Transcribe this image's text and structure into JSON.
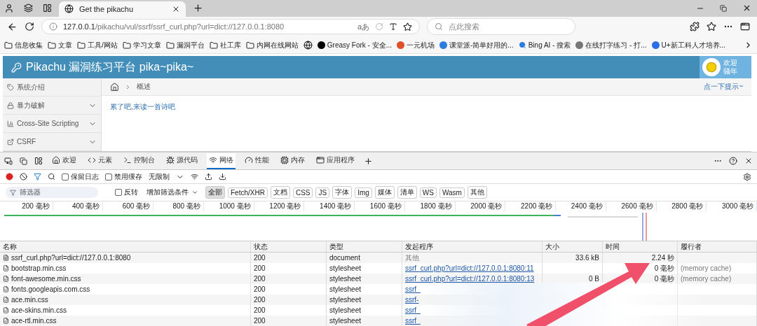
{
  "browser": {
    "tab_title": "Get the pikachu",
    "url_host": "127.0.0.1",
    "url_path": "/pikachu/vul/ssrf/ssrf_curl.php?url=dict://127.0.0.1:8080",
    "search_placeholder": "点此搜索",
    "translate_label": "aあ"
  },
  "bookmarks": [
    {
      "kind": "folder",
      "label": "信息收集"
    },
    {
      "kind": "folder",
      "label": "文章"
    },
    {
      "kind": "folder",
      "label": "工具/网站"
    },
    {
      "kind": "folder",
      "label": "学习文章"
    },
    {
      "kind": "folder",
      "label": "漏洞平台"
    },
    {
      "kind": "folder",
      "label": "社工库"
    },
    {
      "kind": "folder",
      "label": "内网在线网站"
    },
    {
      "kind": "globe"
    },
    {
      "kind": "site",
      "label": "Greasy Fork - 安全...",
      "color": "#000000"
    },
    {
      "kind": "site",
      "label": "一元机场",
      "color": "#e0502a"
    },
    {
      "kind": "site",
      "label": "课堂派-简单好用的...",
      "color": "#2b7de0"
    },
    {
      "kind": "search",
      "label": "Bing AI - 搜索",
      "color": "#2b7de0"
    },
    {
      "kind": "site",
      "label": "在线打字练习 - 打...",
      "color": "#777777"
    },
    {
      "kind": "site",
      "label": "U+新工科人才培养...",
      "color": "#2b6de8"
    }
  ],
  "site": {
    "title": "Pikachu 漏洞练习平台 pika~pika~",
    "welcome": "欢迎",
    "user": "骚年",
    "sidebar": [
      {
        "label": "系统介绍",
        "expandable": false
      },
      {
        "label": "暴力破解",
        "expandable": true
      },
      {
        "label": "Cross-Site Scripting",
        "expandable": true
      },
      {
        "label": "CSRF",
        "expandable": true
      }
    ],
    "breadcrumb": "概述",
    "hint": "点一下提示~",
    "poem_link": "累了吧,来读一首诗吧"
  },
  "devtools": {
    "tabs": [
      {
        "label": "欢迎",
        "selected": false
      },
      {
        "label": "元素",
        "selected": false
      },
      {
        "label": "控制台",
        "selected": false
      },
      {
        "label": "源代码",
        "selected": false
      },
      {
        "label": "网络",
        "selected": true
      },
      {
        "label": "性能",
        "selected": false
      },
      {
        "label": "内存",
        "selected": false
      },
      {
        "label": "应用程序",
        "selected": false
      }
    ],
    "preserve_log": {
      "label": "保留日志",
      "checked": false
    },
    "disable_cache": {
      "label": "禁用缓存",
      "checked": false
    },
    "throttle": "无限制",
    "filter_placeholder": "筛选器",
    "invert": {
      "label": "反转",
      "checked": false
    },
    "more_filters": "增加筛选条件",
    "type_filters": [
      {
        "label": "全部",
        "selected": true
      },
      {
        "label": "Fetch/XHR",
        "selected": false
      },
      {
        "label": "文档",
        "selected": false
      },
      {
        "label": "CSS",
        "selected": false
      },
      {
        "label": "JS",
        "selected": false
      },
      {
        "label": "字体",
        "selected": false
      },
      {
        "label": "Img",
        "selected": false
      },
      {
        "label": "媒体",
        "selected": false
      },
      {
        "label": "清单",
        "selected": false
      },
      {
        "label": "WS",
        "selected": false
      },
      {
        "label": "Wasm",
        "selected": false
      },
      {
        "label": "其他",
        "selected": false
      }
    ],
    "timeline_ticks": [
      "200 毫秒",
      "400 毫秒",
      "600 毫秒",
      "800 毫秒",
      "1000 毫秒",
      "1200 毫秒",
      "1400 毫秒",
      "1600 毫秒",
      "1800 毫秒",
      "2000 毫秒",
      "2200 毫秒",
      "2400 毫秒",
      "2600 毫秒",
      "2800 毫秒",
      "3000 毫秒"
    ],
    "columns": [
      "名称",
      "状态",
      "类型",
      "发起程序",
      "大小",
      "时间",
      "履行者"
    ],
    "rows": [
      {
        "kind": "document",
        "name": "ssrf_curl.php?url=dict://127.0.0.1:8080",
        "status": "200",
        "type": "document",
        "initiator": "其他",
        "initiator_link": false,
        "size": "33.6 kB",
        "time": "2.24 秒"
      },
      {
        "kind": "style",
        "name": "bootstrap.min.css",
        "status": "200",
        "type": "stylesheet",
        "initiator": "ssrf_curl.php?url=dict://127.0.0.1:8080:11",
        "initiator_link": true,
        "time": "0 毫秒",
        "fulfilled": "(memory cache)"
      },
      {
        "kind": "style",
        "name": "font-awesome.min.css",
        "status": "200",
        "type": "stylesheet",
        "initiator": "ssrf_curl.php?url=dict://127.0.0.1:8080:13",
        "initiator_link": true,
        "size": "0 B",
        "time": "0 毫秒",
        "fulfilled": "(memory cache)"
      },
      {
        "kind": "style",
        "name": "fonts.googleapis.com.css",
        "status": "200",
        "type": "stylesheet",
        "initiator": "ssrf_",
        "initiator_link": true
      },
      {
        "kind": "style",
        "name": "ace.min.css",
        "status": "200",
        "type": "stylesheet",
        "initiator": "ssrf-",
        "initiator_link": true
      },
      {
        "kind": "style",
        "name": "ace-skins.min.css",
        "status": "200",
        "type": "stylesheet",
        "initiator": "ssrf_",
        "initiator_link": true
      },
      {
        "kind": "style",
        "name": "ace-rtl.min.css",
        "status": "200",
        "type": "stylesheet",
        "initiator": "ssrf_",
        "initiator_link": true
      }
    ]
  }
}
